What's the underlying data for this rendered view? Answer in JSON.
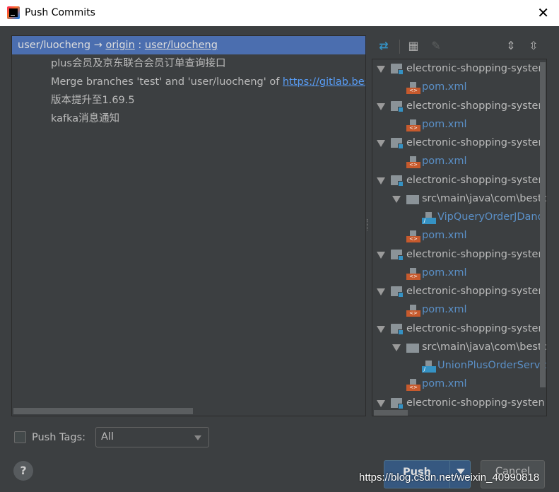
{
  "window": {
    "title": "Push Commits"
  },
  "commits": {
    "branch": {
      "local": "user/luocheng",
      "arrow": "→",
      "remote": "origin",
      "sep": ":",
      "remote_branch": "user/luocheng"
    },
    "items": [
      {
        "text": "plus会员及京东联合会员订单查询接口"
      },
      {
        "text": "Merge branches 'test' and 'user/luocheng' of ",
        "link": "https://gitlab.best"
      },
      {
        "text": "版本提升至1.69.5"
      },
      {
        "text": "kafka消息通知"
      }
    ]
  },
  "toolbar": {
    "icons": [
      "show-diff-icon",
      "group-by-icon",
      "edit-icon",
      "expand-all-icon",
      "collapse-all-icon"
    ]
  },
  "tree": [
    {
      "type": "module",
      "level": 0,
      "name": "electronic-shopping-systen"
    },
    {
      "type": "xml",
      "level": 1,
      "name": "pom.xml"
    },
    {
      "type": "module",
      "level": 0,
      "name": "electronic-shopping-systen"
    },
    {
      "type": "xml",
      "level": 1,
      "name": "pom.xml"
    },
    {
      "type": "module",
      "level": 0,
      "name": "electronic-shopping-systen"
    },
    {
      "type": "xml",
      "level": 1,
      "name": "pom.xml"
    },
    {
      "type": "module",
      "level": 0,
      "name": "electronic-shopping-systen"
    },
    {
      "type": "package",
      "level": 1,
      "name": "src\\main\\java\\com\\bestp"
    },
    {
      "type": "java",
      "level": 2,
      "name": "VipQueryOrderJDand"
    },
    {
      "type": "xml",
      "level": 1,
      "name": "pom.xml"
    },
    {
      "type": "module",
      "level": 0,
      "name": "electronic-shopping-systen"
    },
    {
      "type": "xml",
      "level": 1,
      "name": "pom.xml"
    },
    {
      "type": "module",
      "level": 0,
      "name": "electronic-shopping-systen"
    },
    {
      "type": "xml",
      "level": 1,
      "name": "pom.xml"
    },
    {
      "type": "module",
      "level": 0,
      "name": "electronic-shopping-systen"
    },
    {
      "type": "package",
      "level": 1,
      "name": "src\\main\\java\\com\\bestp"
    },
    {
      "type": "java",
      "level": 2,
      "name": "UnionPlusOrderServic"
    },
    {
      "type": "xml",
      "level": 1,
      "name": "pom.xml"
    },
    {
      "type": "module",
      "level": 0,
      "name": "electronic-shopping-systen"
    }
  ],
  "footer": {
    "push_tags_label": "Push Tags:",
    "push_tags_checked": false,
    "tags_select": "All",
    "help": "?",
    "push_label": "Push",
    "cancel_label": "Cancel",
    "watermark": "https://blog.csdn.net/weixin_40990818"
  },
  "colors": {
    "selection": "#4b6eaf",
    "link": "#589df6",
    "file_link": "#5a8fc6",
    "xml": "#c75a2d",
    "java": "#3592c4"
  }
}
